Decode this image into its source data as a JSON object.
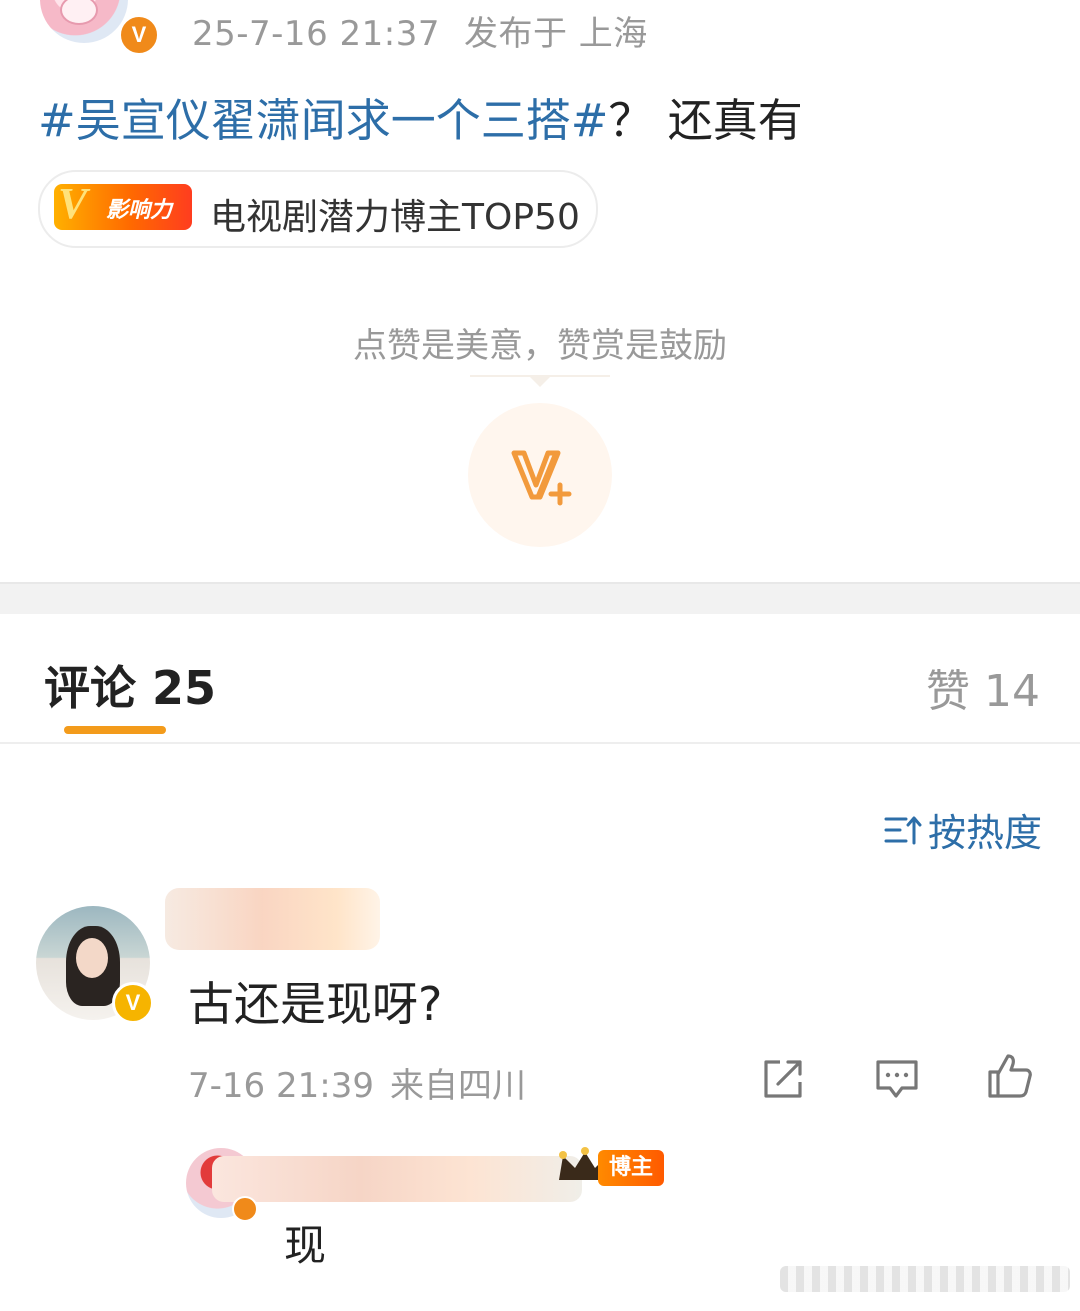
{
  "post": {
    "timestamp": "25-7-16 21:37",
    "location": "发布于 上海",
    "hashtag": "#吴宣仪翟潇闻求一个三搭#",
    "text": "？ 还真有",
    "badge_logo_text": "影响力",
    "badge_text": "电视剧潜力博主TOP50",
    "avatar_badge": "V"
  },
  "reward": {
    "hint": "点赞是美意，赞赏是鼓励",
    "icon": "v-plus-icon"
  },
  "tabs": {
    "comments_label": "评论",
    "comments_count": "25",
    "likes_label": "赞",
    "likes_count": "14"
  },
  "sort": {
    "label": "按热度",
    "icon": "sort-icon"
  },
  "comments": [
    {
      "text": "古还是现呀?",
      "timestamp": "7-16 21:39",
      "location": "来自四川",
      "avatar_badge": "V",
      "actions": [
        "share-icon",
        "comment-icon",
        "like-icon"
      ]
    }
  ],
  "replies": [
    {
      "role_badge": "博主",
      "text": "现"
    }
  ],
  "colors": {
    "link": "#2d6ea8",
    "accent": "#f39b1b",
    "muted": "#999999",
    "badge_orange": "#f08a1a",
    "badge_yellow": "#f6b400"
  }
}
